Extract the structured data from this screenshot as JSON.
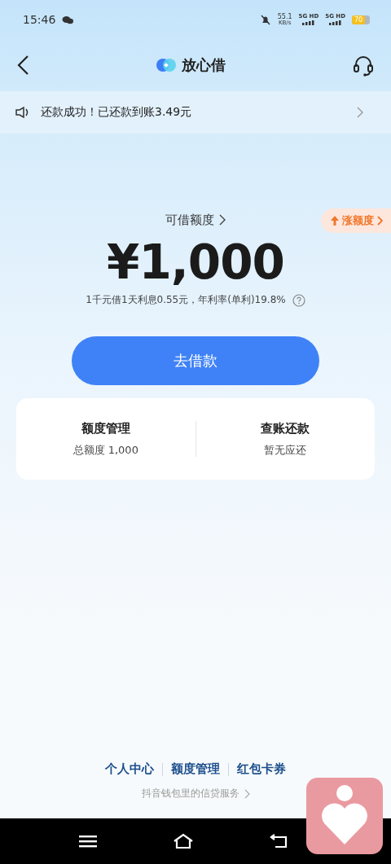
{
  "status_bar": {
    "time": "15:46",
    "speed": "55.1",
    "speed_unit": "KB/s",
    "sims": [
      "5G HD",
      "5G HD"
    ],
    "battery": "70"
  },
  "header": {
    "title": "放心借"
  },
  "notice": {
    "text": "还款成功！已还款到账3.49元"
  },
  "credit": {
    "label": "可借额度",
    "boost": "涨额度",
    "amount": "¥1,000",
    "rate_note": "1千元借1天利息0.55元，年利率(单利)19.8%"
  },
  "primary_button": "去借款",
  "cards": [
    {
      "title": "额度管理",
      "subtitle": "总额度 1,000"
    },
    {
      "title": "查账还款",
      "subtitle": "暂无应还"
    }
  ],
  "footer_links": [
    "个人中心",
    "额度管理",
    "红包卡券"
  ],
  "service_link": "抖音钱包里的信贷服务"
}
